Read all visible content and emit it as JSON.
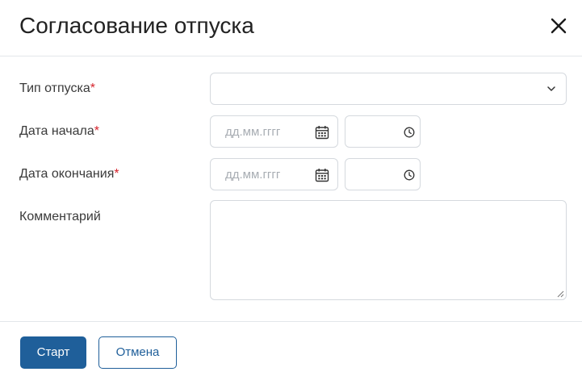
{
  "dialog": {
    "title": "Согласование отпуска"
  },
  "form": {
    "required_mark": "*",
    "vacation_type": {
      "label": "Тип отпуска",
      "value": ""
    },
    "start_date": {
      "label": "Дата начала",
      "date_placeholder": "дд.мм.гггг",
      "time_value": ""
    },
    "end_date": {
      "label": "Дата окончания",
      "date_placeholder": "дд.мм.гггг",
      "time_value": ""
    },
    "comment": {
      "label": "Комментарий",
      "value": ""
    }
  },
  "footer": {
    "start_label": "Старт",
    "cancel_label": "Отмена"
  },
  "colors": {
    "primary": "#1f5f9a",
    "required": "#d6232c",
    "border": "#d5d9de",
    "placeholder": "#a8adb3"
  },
  "icons": {
    "close": "close-icon",
    "dropdown": "chevron-down-icon",
    "date": "calendar-icon",
    "time": "clock-icon",
    "resize": "resize-grip-icon"
  }
}
